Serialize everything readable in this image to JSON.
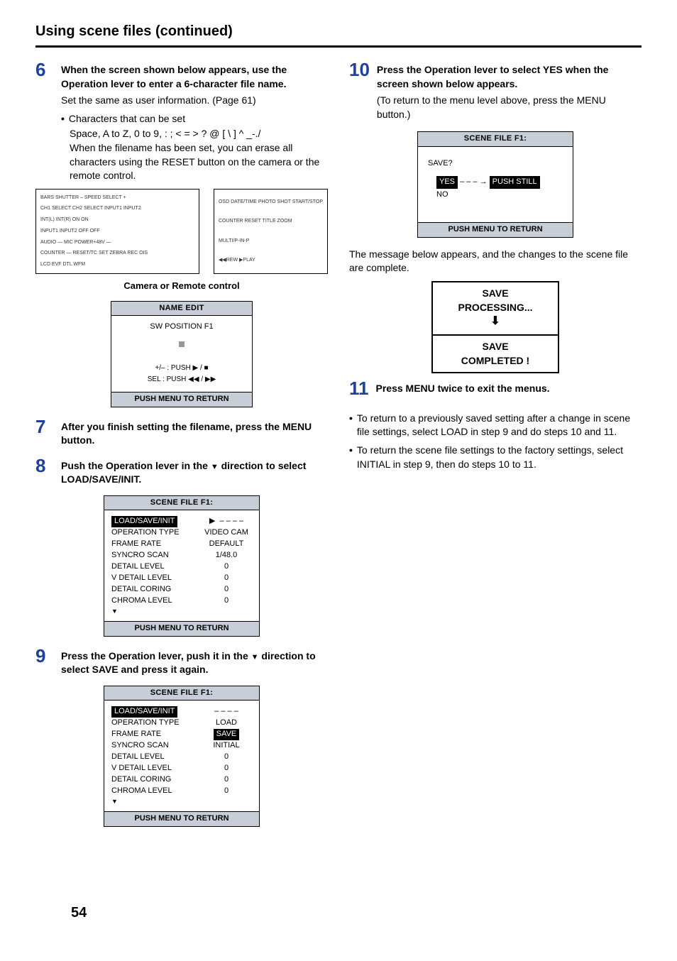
{
  "page": {
    "title": "Using scene files (continued)",
    "number": "54"
  },
  "step6": {
    "num": "6",
    "head": "When the screen shown below appears, use the Operation lever to enter a 6-character file name.",
    "sub": "Set the same as user information. (Page 61)",
    "bullet_label": "Characters that can be set",
    "chars_line": "Space, A to Z, 0 to 9, : ; < = > ? @ [ \\ ] ^ _-./",
    "erase_line": "When the filename has been set, you can erase all characters using the RESET button on the camera or the remote control."
  },
  "diagram": {
    "left": {
      "row1": "BARS   SHUTTER   – SPEED SELECT +",
      "row2": "CH1 SELECT  CH2 SELECT   INPUT1   INPUT2",
      "row3": "INT(L)  INT(R)   ON   ON",
      "row4": "INPUT1  INPUT2   OFF  OFF",
      "row5": "AUDIO   — MIC POWER+48V —",
      "row6": "COUNTER — RESET/TC SET   ZEBRA  REC  OIS",
      "row7": "LCD   EVF DTL   WFM"
    },
    "right": {
      "row1": "OSD  DATE/TIME  PHOTO SHOT  START/STOP",
      "row2": "COUNTER  RESET  TITLE  ZOOM",
      "row3": "MULTI/P-IN-P",
      "row4": "◀◀REW  ▶PLAY"
    },
    "caption": "Camera or Remote control"
  },
  "name_edit": {
    "title": "NAME EDIT",
    "line1": "SW POSITION F1",
    "hint1": "+/– : PUSH ▶ / ■",
    "hint2": "SEL : PUSH ◀◀ / ▶▶",
    "footer": "PUSH  MENU TO RETURN"
  },
  "step7": {
    "num": "7",
    "head": "After you finish setting the filename, press the MENU button."
  },
  "step8": {
    "num": "8",
    "head_pre": "Push the Operation lever in the ",
    "head_post": " direction to select LOAD/SAVE/INIT.",
    "tri": "▼"
  },
  "scene_f1_a": {
    "title": "SCENE FILE F1:",
    "rows": [
      {
        "k": "LOAD/SAVE/INIT",
        "v": "– – – –",
        "hl": true,
        "ptr": "▶"
      },
      {
        "k": "OPERATION TYPE",
        "v": "VIDEO CAM"
      },
      {
        "k": "FRAME RATE",
        "v": "DEFAULT"
      },
      {
        "k": "SYNCRO SCAN",
        "v": "1/48.0"
      },
      {
        "k": "DETAIL LEVEL",
        "v": "0"
      },
      {
        "k": "V DETAIL LEVEL",
        "v": "0"
      },
      {
        "k": "DETAIL CORING",
        "v": "0"
      },
      {
        "k": "CHROMA LEVEL",
        "v": "0"
      }
    ],
    "footer": "PUSH  MENU TO RETURN"
  },
  "step9": {
    "num": "9",
    "head_pre": "Press the Operation lever, push it in the ",
    "head_post": " direction to select SAVE and press it again.",
    "tri": "▼"
  },
  "scene_f1_b": {
    "title": "SCENE FILE F1:",
    "rows": [
      {
        "k": "LOAD/SAVE/INIT",
        "v": "– – – –",
        "hl": true
      },
      {
        "k": "OPERATION TYPE",
        "v": "LOAD"
      },
      {
        "k": "FRAME RATE",
        "v": "SAVE",
        "vhl": true
      },
      {
        "k": "SYNCRO SCAN",
        "v": "INITIAL"
      },
      {
        "k": "DETAIL LEVEL",
        "v": "0"
      },
      {
        "k": "V DETAIL LEVEL",
        "v": "0"
      },
      {
        "k": "DETAIL CORING",
        "v": "0"
      },
      {
        "k": "CHROMA LEVEL",
        "v": "0"
      }
    ],
    "footer": "PUSH  MENU TO RETURN"
  },
  "step10": {
    "num": "10",
    "head": "Press the Operation lever to select YES when the screen shown below appears.",
    "sub": "(To return to the menu level above, press the MENU button.)"
  },
  "save_confirm": {
    "title": "SCENE FILE F1:",
    "q": "SAVE?",
    "yes_label": "YES",
    "yes_tail": "PUSH STILL",
    "arrow": "– – – →",
    "no": "NO",
    "footer": "PUSH  MENU TO RETURN"
  },
  "message_text": "The message below appears, and the changes to the scene file are complete.",
  "state": {
    "a1": "SAVE",
    "a2": "PROCESSING...",
    "b1": "SAVE",
    "b2": "COMPLETED !"
  },
  "step11": {
    "num": "11",
    "head": "Press MENU twice to exit the menus."
  },
  "notes": {
    "n1": "To return to a previously saved setting after a change in scene file settings, select LOAD in step 9 and do steps 10 and 11.",
    "n2": "To return the scene file settings to the factory settings, select INITIAL in step 9, then do steps 10 to 11."
  }
}
